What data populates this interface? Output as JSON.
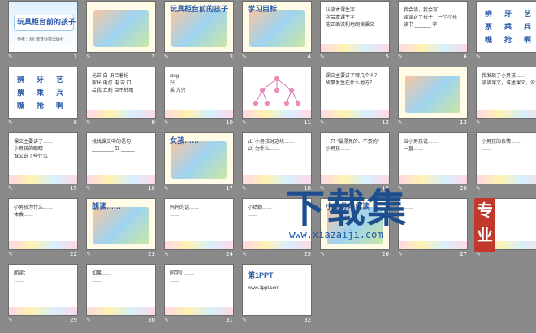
{
  "slides": [
    {
      "n": "1",
      "kind": "title",
      "text": [
        "玩具柜台前的孩子",
        "作者：XX 教育科技出版社"
      ]
    },
    {
      "n": "2",
      "kind": "art",
      "text": []
    },
    {
      "n": "3",
      "kind": "art",
      "text": [
        "玩具柜台前的孩子"
      ]
    },
    {
      "n": "4",
      "kind": "art",
      "text": [
        "学习目标"
      ]
    },
    {
      "n": "5",
      "kind": "text",
      "text": [
        "认读本课生字",
        "学会本课生字",
        "能正确流利地朗读课文"
      ]
    },
    {
      "n": "6",
      "kind": "text",
      "text": [
        "我会读，我会写：",
        "读读这个孩子，一个小孩",
        "读书 ______ 字"
      ]
    },
    {
      "n": "7",
      "kind": "chars",
      "text": [
        "辨",
        "牙",
        "艺",
        "票",
        "乘",
        "兵",
        "瞧",
        "抢",
        "啊"
      ]
    },
    {
      "n": "8",
      "kind": "chars",
      "text": [
        "辨",
        "牙",
        "艺",
        "票",
        "乘",
        "兵",
        "瞧",
        "抢",
        "啊"
      ]
    },
    {
      "n": "9",
      "kind": "text",
      "text": [
        "光芒 白 识吕着份",
        "家长 电灯 电 苦 口",
        "给我 立刻 目不转睛"
      ]
    },
    {
      "n": "10",
      "kind": "text",
      "text": [
        "xing",
        "兴",
        "乘 为兴"
      ]
    },
    {
      "n": "11",
      "kind": "tree",
      "text": []
    },
    {
      "n": "12",
      "kind": "text",
      "text": [
        "课文主要讲了哪几个人？",
        "故事发生在什么地方？"
      ]
    },
    {
      "n": "13",
      "kind": "art",
      "text": []
    },
    {
      "n": "14",
      "kind": "text",
      "text": [
        "我发现了小男孩……",
        "读读课文，讲述课文，说说"
      ]
    },
    {
      "n": "15",
      "kind": "text",
      "text": [
        "课文主要讲了……",
        "小男孩的眼睛",
        "谁又说了些什么"
      ]
    },
    {
      "n": "16",
      "kind": "text",
      "text": [
        "找找课文中的语句",
        "________ 又 _____"
      ]
    },
    {
      "n": "17",
      "kind": "art",
      "text": [
        "女孩……"
      ]
    },
    {
      "n": "18",
      "kind": "text",
      "text": [
        "(1) 小男孩对这块……",
        "(2) 为什么……"
      ]
    },
    {
      "n": "19",
      "kind": "text",
      "text": [
        "一只 \"最漂亮的、不贵的\"",
        "小男孩……"
      ]
    },
    {
      "n": "20",
      "kind": "text",
      "text": [
        "当小男孩说……",
        "一直……"
      ]
    },
    {
      "n": "21",
      "kind": "text",
      "text": [
        "小男孩的表情……",
        "……"
      ]
    },
    {
      "n": "22",
      "kind": "text",
      "text": [
        "小男孩为什么……",
        "体会……"
      ]
    },
    {
      "n": "23",
      "kind": "art",
      "text": [
        "朗读……"
      ]
    },
    {
      "n": "24",
      "kind": "text",
      "text": [
        "妈妈的话……",
        "……"
      ]
    },
    {
      "n": "25",
      "kind": "text",
      "text": [
        "小姑娘……",
        "……"
      ]
    },
    {
      "n": "26",
      "kind": "art",
      "text": [
        "小组分角色读"
      ]
    },
    {
      "n": "27",
      "kind": "text",
      "text": [
        "……"
      ]
    },
    {
      "n": "28",
      "kind": "text",
      "text": [
        "……"
      ]
    },
    {
      "n": "29",
      "kind": "text",
      "text": [
        "朗读：",
        "……"
      ]
    },
    {
      "n": "30",
      "kind": "text",
      "text": [
        "如果……",
        "……"
      ]
    },
    {
      "n": "31",
      "kind": "text",
      "text": [
        "同学们……",
        "……"
      ]
    },
    {
      "n": "32",
      "kind": "ad",
      "text": [
        "第1PPT",
        "www.1ppt.com"
      ]
    }
  ],
  "watermark": {
    "main": "下载集",
    "url": "www.xiazaiji.com",
    "seal": [
      "专",
      "业"
    ]
  }
}
